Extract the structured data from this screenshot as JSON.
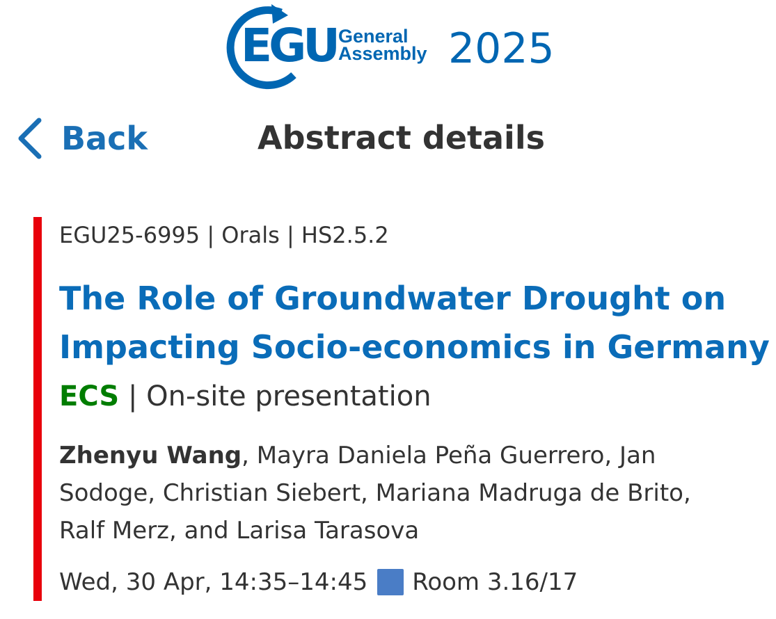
{
  "header": {
    "logo": {
      "acronym": "EGU",
      "subtitle_line1": "General",
      "subtitle_line2": "Assembly",
      "year": "2025",
      "brand_color": "#0066b2"
    },
    "back_label": "Back",
    "back_icon": "chevron-left-icon",
    "page_title": "Abstract details"
  },
  "abstract": {
    "accent_color": "#e8000b",
    "meta": "EGU25-6995 | Orals | HS2.5.2",
    "title_line1": "The Role of Groundwater Drought on",
    "title_line2": "Impacting Socio-economics in Germany",
    "title_color": "#0a6cb8",
    "ecs_label": "ECS",
    "ecs_color": "#007d00",
    "presentation_separator": " | ",
    "presentation_type": "On-site presentation",
    "authors": {
      "presenter": "Zhenyu Wang",
      "line1_rest": ", Mayra Daniela Peña Guerrero, Jan",
      "line2": "Sodoge, Christian Siebert, Mariana Madruga de Brito,",
      "line3": "Ralf Merz, and Larisa Tarasova"
    },
    "session": {
      "datetime": "Wed, 30 Apr, 14:35–14:45",
      "room_color": "#4a7dc6",
      "room": "Room 3.16/17"
    }
  }
}
